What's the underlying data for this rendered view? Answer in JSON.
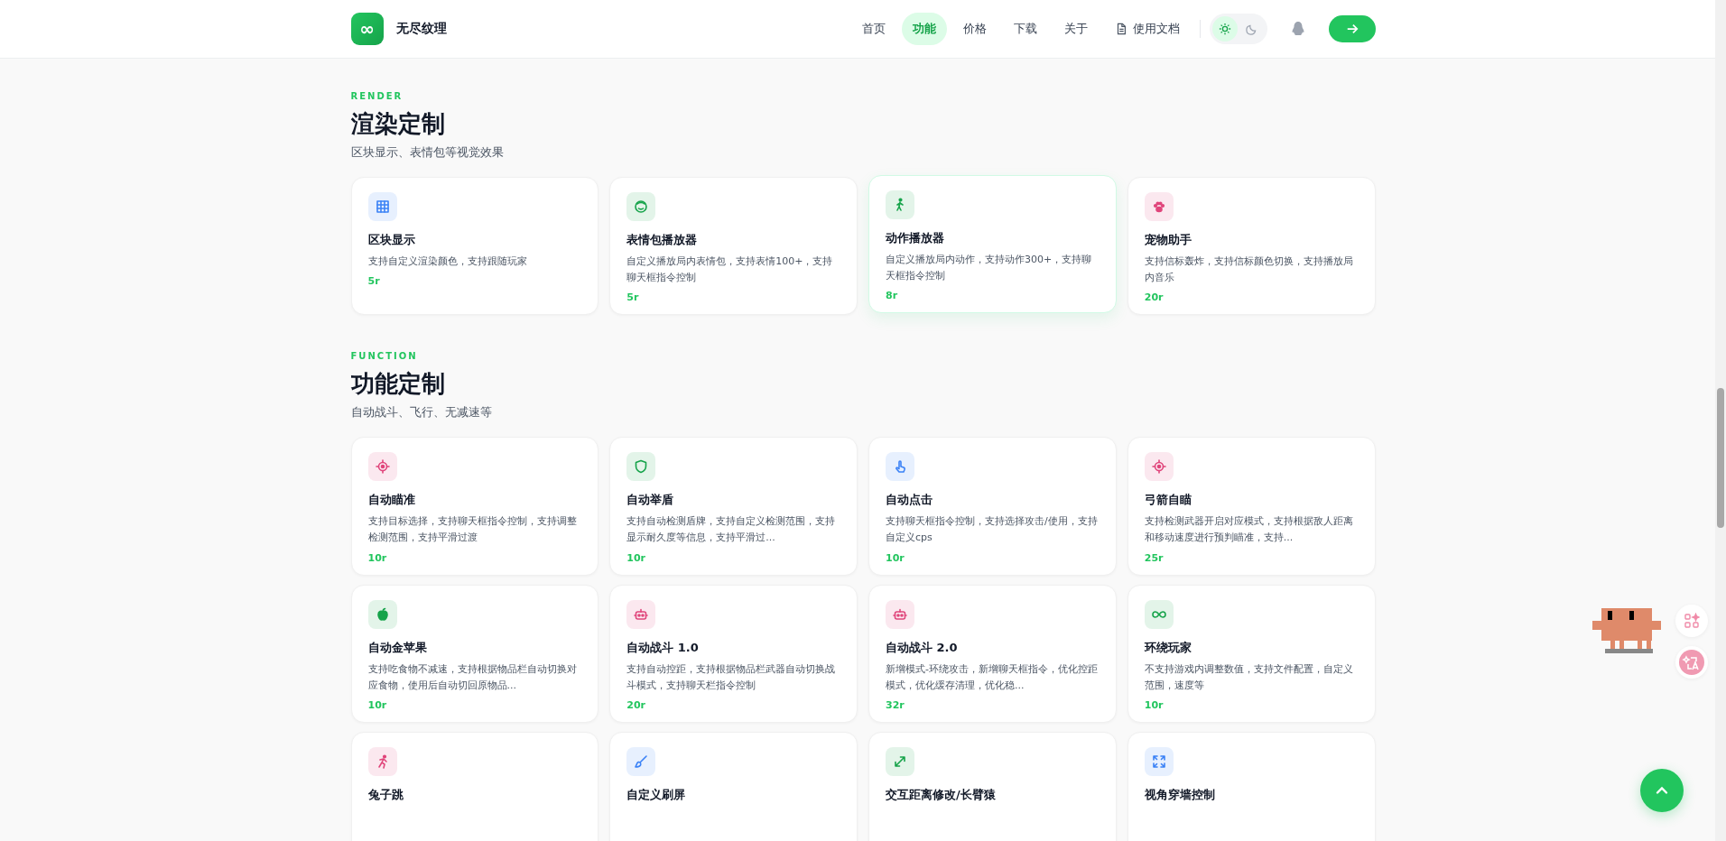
{
  "header": {
    "logo_text": "∞",
    "brand": "无尽纹理",
    "nav": [
      {
        "label": "首页",
        "selected": false
      },
      {
        "label": "功能",
        "selected": true
      },
      {
        "label": "价格",
        "selected": false
      },
      {
        "label": "下载",
        "selected": false
      },
      {
        "label": "关于",
        "selected": false
      }
    ],
    "docs_link": "使用文档",
    "theme": {
      "light_selected": true
    }
  },
  "sections": [
    {
      "label": "RENDER",
      "title": "渲染定制",
      "subtitle": "区块显示、表情包等视觉效果",
      "cards": [
        {
          "title": "区块显示",
          "desc": "支持自定义渲染颜色，支持跟随玩家",
          "price": "5r",
          "color": "#3b82f6",
          "hovered": false
        },
        {
          "title": "表情包播放器",
          "desc": "自定义播放局内表情包，支持表情100+，支持聊天框指令控制",
          "price": "5r",
          "color": "#16a34a",
          "hovered": false
        },
        {
          "title": "动作播放器",
          "desc": "自定义播放局内动作，支持动作300+，支持聊天框指令控制",
          "price": "8r",
          "color": "#16a34a",
          "hovered": true
        },
        {
          "title": "宠物助手",
          "desc": "支持信标轰炸，支持信标颜色切换，支持播放局内音乐",
          "price": "20r",
          "color": "#e0457b",
          "hovered": false
        }
      ]
    },
    {
      "label": "FUNCTION",
      "title": "功能定制",
      "subtitle": "自动战斗、飞行、无减速等",
      "cards": [
        {
          "title": "自动瞄准",
          "desc": "支持目标选择，支持聊天框指令控制，支持调整检测范围，支持平滑过渡",
          "price": "10r",
          "color": "#e0457b",
          "hovered": false
        },
        {
          "title": "自动举盾",
          "desc": "支持自动检测盾牌，支持自定义检测范围，支持显示耐久度等信息，支持平滑过...",
          "price": "10r",
          "color": "#16a34a",
          "hovered": false
        },
        {
          "title": "自动点击",
          "desc": "支持聊天框指令控制，支持选择攻击/使用，支持自定义cps",
          "price": "10r",
          "color": "#3b82f6",
          "hovered": false
        },
        {
          "title": "弓箭自瞄",
          "desc": "支持检测武器开启对应模式，支持根据敌人距离和移动速度进行预判瞄准，支持...",
          "price": "25r",
          "color": "#e0457b",
          "hovered": false
        },
        {
          "title": "自动金苹果",
          "desc": "支持吃食物不减速，支持根据物品栏自动切换对应食物，使用后自动切回原物品...",
          "price": "10r",
          "color": "#16a34a",
          "hovered": false
        },
        {
          "title": "自动战斗 1.0",
          "desc": "支持自动控距，支持根据物品栏武器自动切换战斗模式，支持聊天栏指令控制",
          "price": "20r",
          "color": "#e0457b",
          "hovered": false
        },
        {
          "title": "自动战斗 2.0",
          "desc": "新增模式-环绕攻击，新增聊天框指令，优化控距模式，优化缓存清理，优化稳...",
          "price": "32r",
          "color": "#e0457b",
          "hovered": false
        },
        {
          "title": "环绕玩家",
          "desc": "不支持游戏内调整数值，支持文件配置，自定义范围，速度等",
          "price": "10r",
          "color": "#16a34a",
          "hovered": false
        },
        {
          "title": "兔子跳",
          "color": "#e0457b",
          "hovered": false
        },
        {
          "title": "自定义刷屏",
          "color": "#3b82f6",
          "hovered": false
        },
        {
          "title": "交互距离修改/长臂猿",
          "color": "#16a34a",
          "hovered": false
        },
        {
          "title": "视角穿墙控制",
          "color": "#3b82f6",
          "hovered": false
        }
      ]
    }
  ]
}
